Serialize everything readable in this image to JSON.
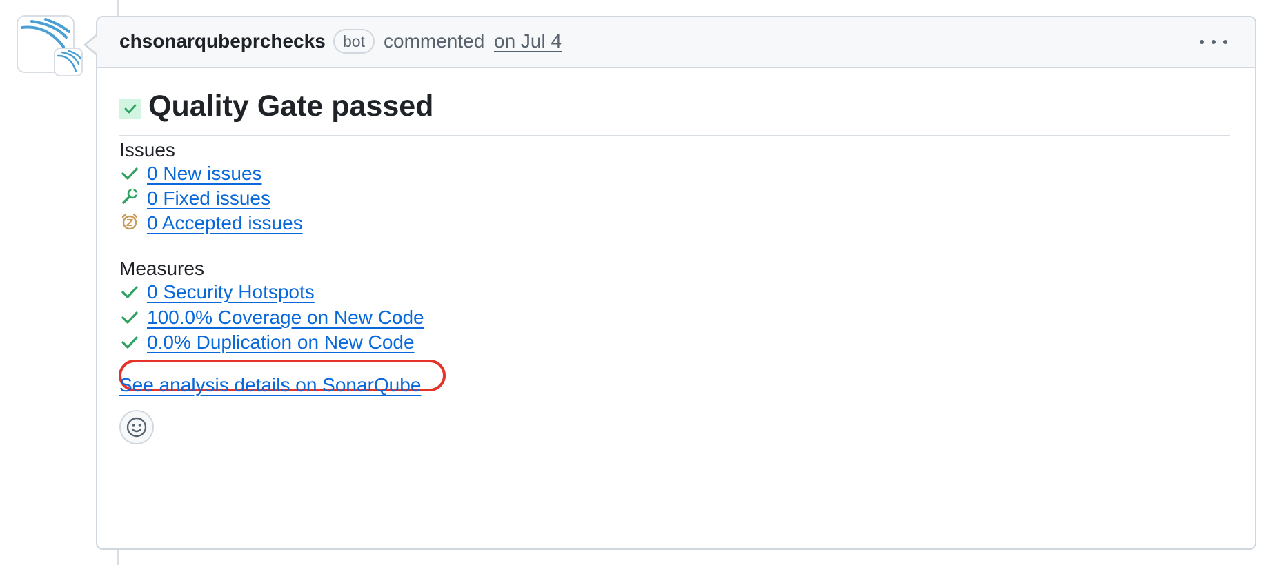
{
  "comment": {
    "author": "chsonarqubeprchecks",
    "badge": "bot",
    "action": "commented",
    "date": "on Jul 4",
    "menu_icon": "kebab-horizontal-icon"
  },
  "quality_gate": {
    "icon": "check-square-icon",
    "title": "Quality Gate passed"
  },
  "issues": {
    "heading": "Issues",
    "items": [
      {
        "icon": "check-icon",
        "label": "0 New issues"
      },
      {
        "icon": "wrench-icon",
        "label": "0 Fixed issues"
      },
      {
        "icon": "alarm-clock-icon",
        "label": "0 Accepted issues"
      }
    ]
  },
  "measures": {
    "heading": "Measures",
    "items": [
      {
        "icon": "check-icon",
        "label": "0 Security Hotspots"
      },
      {
        "icon": "check-icon",
        "label": "100.0% Coverage on New Code",
        "highlighted": true
      },
      {
        "icon": "check-icon",
        "label": "0.0% Duplication on New Code"
      }
    ]
  },
  "footer": {
    "details_link": "See analysis details on SonarQube",
    "reaction_icon": "smiley-icon"
  },
  "colors": {
    "link": "#0969da",
    "check": "#2da160",
    "highlight": "#e5332a",
    "muted": "#59636e"
  }
}
